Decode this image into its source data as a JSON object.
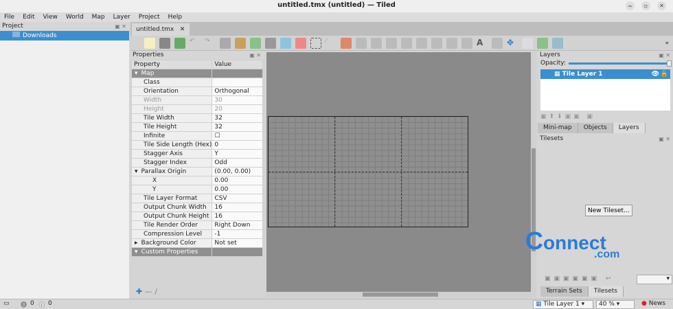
{
  "window": {
    "title": "untitled.tmx (untitled) — Tiled"
  },
  "menu": [
    "File",
    "Edit",
    "View",
    "World",
    "Map",
    "Layer",
    "Project",
    "Help"
  ],
  "project": {
    "title": "Project",
    "item": "Downloads"
  },
  "tab": {
    "label": "untitled.tmx",
    "close": "✕"
  },
  "properties": {
    "title": "Properties",
    "col_property": "Property",
    "col_value": "Value",
    "rows": [
      {
        "k": "Map",
        "v": "",
        "t": "grp",
        "exp": "▾"
      },
      {
        "k": "Class",
        "v": ""
      },
      {
        "k": "Orientation",
        "v": "Orthogonal"
      },
      {
        "k": "Width",
        "v": "30",
        "t": "dis"
      },
      {
        "k": "Height",
        "v": "20",
        "t": "dis"
      },
      {
        "k": "Tile Width",
        "v": "32"
      },
      {
        "k": "Tile Height",
        "v": "32"
      },
      {
        "k": "Infinite",
        "v": "☐"
      },
      {
        "k": "Tile Side Length (Hex)",
        "v": "0"
      },
      {
        "k": "Stagger Axis",
        "v": "Y"
      },
      {
        "k": "Stagger Index",
        "v": "Odd"
      },
      {
        "k": "Parallax Origin",
        "v": "(0.00, 0.00)",
        "exp": "▾"
      },
      {
        "k": "X",
        "v": "0.00",
        "ind": 1
      },
      {
        "k": "Y",
        "v": "0.00",
        "ind": 1
      },
      {
        "k": "Tile Layer Format",
        "v": "CSV"
      },
      {
        "k": "Output Chunk Width",
        "v": "16"
      },
      {
        "k": "Output Chunk Height",
        "v": "16"
      },
      {
        "k": "Tile Render Order",
        "v": "Right Down"
      },
      {
        "k": "Compression Level",
        "v": "-1"
      },
      {
        "k": "Background Color",
        "v": "Not set",
        "exp": "▸"
      },
      {
        "k": "Custom Properties",
        "v": "",
        "t": "grp",
        "exp": "▾"
      }
    ]
  },
  "layers": {
    "title": "Layers",
    "opacity_label": "Opacity:",
    "opacity": 1.0,
    "items": [
      "Tile Layer 1"
    ]
  },
  "right_tabs": [
    "Mini-map",
    "Objects",
    "Layers"
  ],
  "tilesets": {
    "title": "Tilesets",
    "new_button": "New Tileset..."
  },
  "bottom_tabs": [
    "Terrain Sets",
    "Tilesets"
  ],
  "status": {
    "warnings": "0",
    "errors": "0",
    "layer": "Tile Layer 1",
    "zoom": "40 %",
    "news": "News"
  },
  "watermark": "connect.com"
}
